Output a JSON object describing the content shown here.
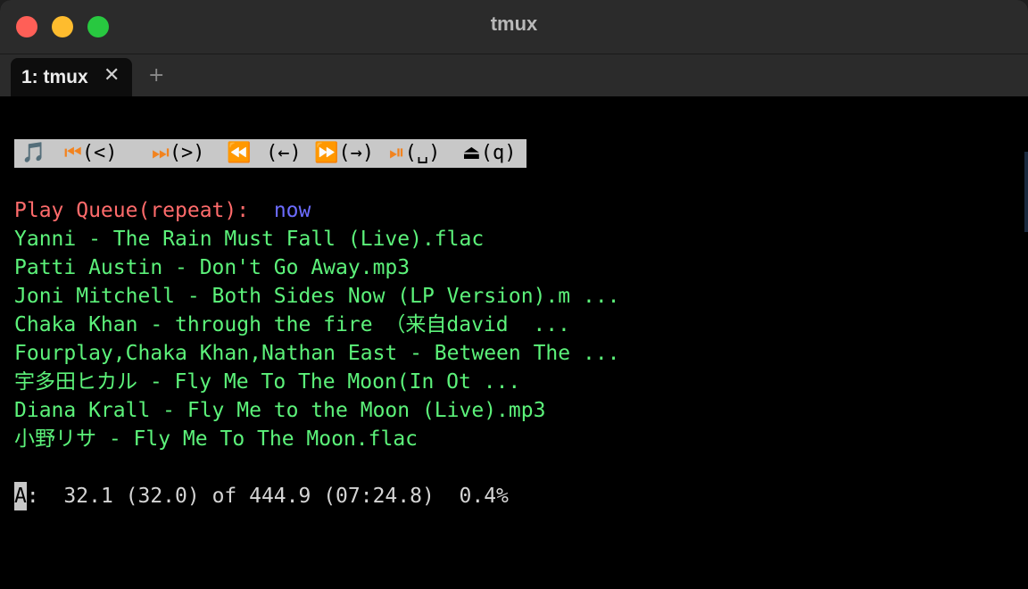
{
  "window": {
    "title": "tmux",
    "tabs": [
      {
        "label": "1: tmux",
        "close": "✕"
      }
    ],
    "new_tab": "+"
  },
  "controls": {
    "music_icon": "music-note-icon",
    "items": [
      {
        "icon": "previous-track-icon",
        "glyph": "⏮",
        "key": "(<)"
      },
      {
        "icon": "next-track-icon",
        "glyph": "⏭",
        "key": "(>)"
      },
      {
        "icon": "rewind-icon",
        "glyph": "⏪",
        "key": "(←)"
      },
      {
        "icon": "fast-forward-icon",
        "glyph": "⏩",
        "key": "(→)"
      },
      {
        "icon": "play-pause-icon",
        "glyph": "⏯",
        "key": "(␣)"
      },
      {
        "icon": "eject-icon",
        "glyph": "⏏",
        "key": "(q)"
      }
    ],
    "music_glyph": "🎵"
  },
  "queue": {
    "label": "Play Queue(repeat):",
    "now": "now",
    "tracks": [
      "Yanni - The Rain Must Fall (Live).flac",
      "Patti Austin - Don't Go Away.mp3",
      "Joni Mitchell - Both Sides Now (LP Version).m ...",
      "Chaka Khan - through the fire （来自david  ...",
      "Fourplay,Chaka Khan,Nathan East - Between The ...",
      "宇多田ヒカル - Fly Me To The Moon(In Ot ...",
      "Diana Krall - Fly Me to the Moon (Live).mp3",
      "小野リサ - Fly Me To The Moon.flac"
    ]
  },
  "status": {
    "cursor_char": "A",
    "text": ":  32.1 (32.0) of 444.9 (07:24.8)  0.4%"
  },
  "colors": {
    "track": "#5cf27a",
    "queue_label": "#ff6b6b",
    "queue_now": "#6c6cff",
    "controls_bg": "#c8c8c8"
  }
}
